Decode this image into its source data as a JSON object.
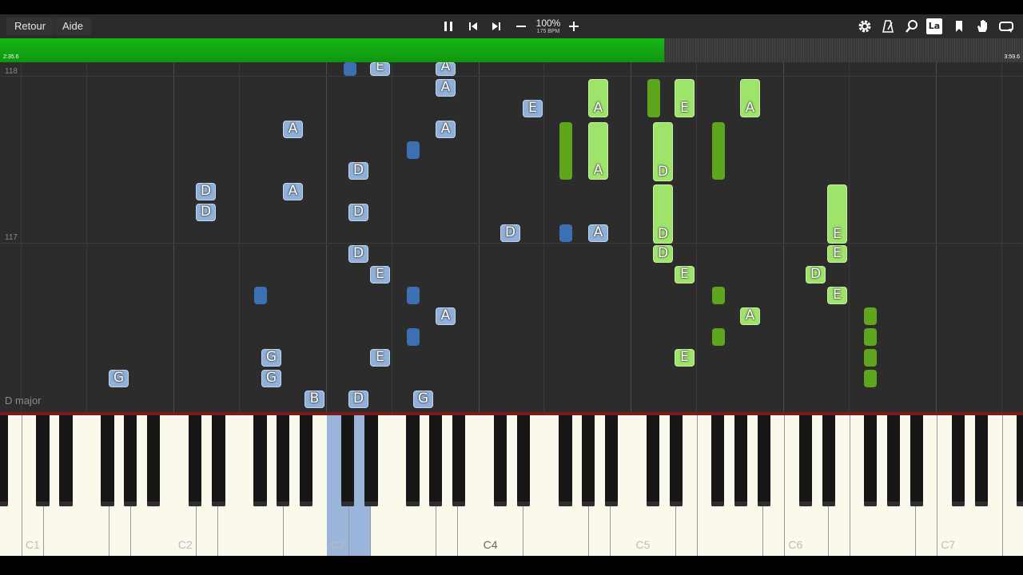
{
  "toolbar": {
    "back_label": "Retour",
    "help_label": "Aide",
    "speed_percent": "100%",
    "tempo": "175 BPM",
    "right_icons": [
      "gear-icon",
      "metronome-icon",
      "search-icon",
      "label-icon",
      "bookmark-icon",
      "hand-icon",
      "loop-icon"
    ],
    "label_icon_text": "La"
  },
  "progress": {
    "elapsed": "2:35.6",
    "total": "3:59.6",
    "fraction": 0.649
  },
  "roll": {
    "measures": [
      "118",
      "117"
    ],
    "key_signature": "D major"
  },
  "keyboard": {
    "octave_labels": [
      "C1",
      "C2",
      "C3",
      "C4",
      "C5",
      "C6",
      "C7"
    ]
  },
  "notes": [
    {
      "hand": "left",
      "label": "E"
    },
    {
      "hand": "left",
      "label": "A"
    },
    {
      "hand": "left",
      "label": ""
    },
    {
      "hand": "left",
      "label": "A"
    },
    {
      "hand": "left",
      "label": "A"
    },
    {
      "hand": "left",
      "label": "A"
    },
    {
      "hand": "left",
      "label": ""
    },
    {
      "hand": "left",
      "label": "D"
    },
    {
      "hand": "left",
      "label": "D"
    },
    {
      "hand": "left",
      "label": "A"
    },
    {
      "hand": "left",
      "label": "D"
    },
    {
      "hand": "left",
      "label": "D"
    },
    {
      "hand": "left",
      "label": "D"
    },
    {
      "hand": "left",
      "label": ""
    },
    {
      "hand": "left",
      "label": "A"
    },
    {
      "hand": "left",
      "label": "D"
    },
    {
      "hand": "left",
      "label": "E"
    },
    {
      "hand": "left",
      "label": ""
    },
    {
      "hand": "left",
      "label": ""
    },
    {
      "hand": "left",
      "label": "A"
    },
    {
      "hand": "left",
      "label": ""
    },
    {
      "hand": "left",
      "label": "G"
    },
    {
      "hand": "left",
      "label": "E"
    },
    {
      "hand": "left",
      "label": "G"
    },
    {
      "hand": "left",
      "label": "G"
    },
    {
      "hand": "left",
      "label": "B"
    },
    {
      "hand": "left",
      "label": "D"
    },
    {
      "hand": "left",
      "label": "G"
    },
    {
      "hand": "left",
      "label": "E"
    },
    {
      "hand": "right",
      "label": "A"
    },
    {
      "hand": "right",
      "label": ""
    },
    {
      "hand": "right",
      "label": "E"
    },
    {
      "hand": "right",
      "label": "A"
    },
    {
      "hand": "right",
      "label": ""
    },
    {
      "hand": "right",
      "label": "A"
    },
    {
      "hand": "right",
      "label": "D"
    },
    {
      "hand": "right",
      "label": ""
    },
    {
      "hand": "right",
      "label": "D"
    },
    {
      "hand": "right",
      "label": "E"
    },
    {
      "hand": "right",
      "label": "D"
    },
    {
      "hand": "right",
      "label": "E"
    },
    {
      "hand": "right",
      "label": "D"
    },
    {
      "hand": "right",
      "label": "E"
    },
    {
      "hand": "right",
      "label": ""
    },
    {
      "hand": "right",
      "label": "E"
    },
    {
      "hand": "right",
      "label": "A"
    },
    {
      "hand": "right",
      "label": ""
    },
    {
      "hand": "right",
      "label": ""
    },
    {
      "hand": "right",
      "label": "E"
    },
    {
      "hand": "right",
      "label": ""
    },
    {
      "hand": "right",
      "label": ""
    },
    {
      "hand": "right",
      "label": ""
    }
  ]
}
